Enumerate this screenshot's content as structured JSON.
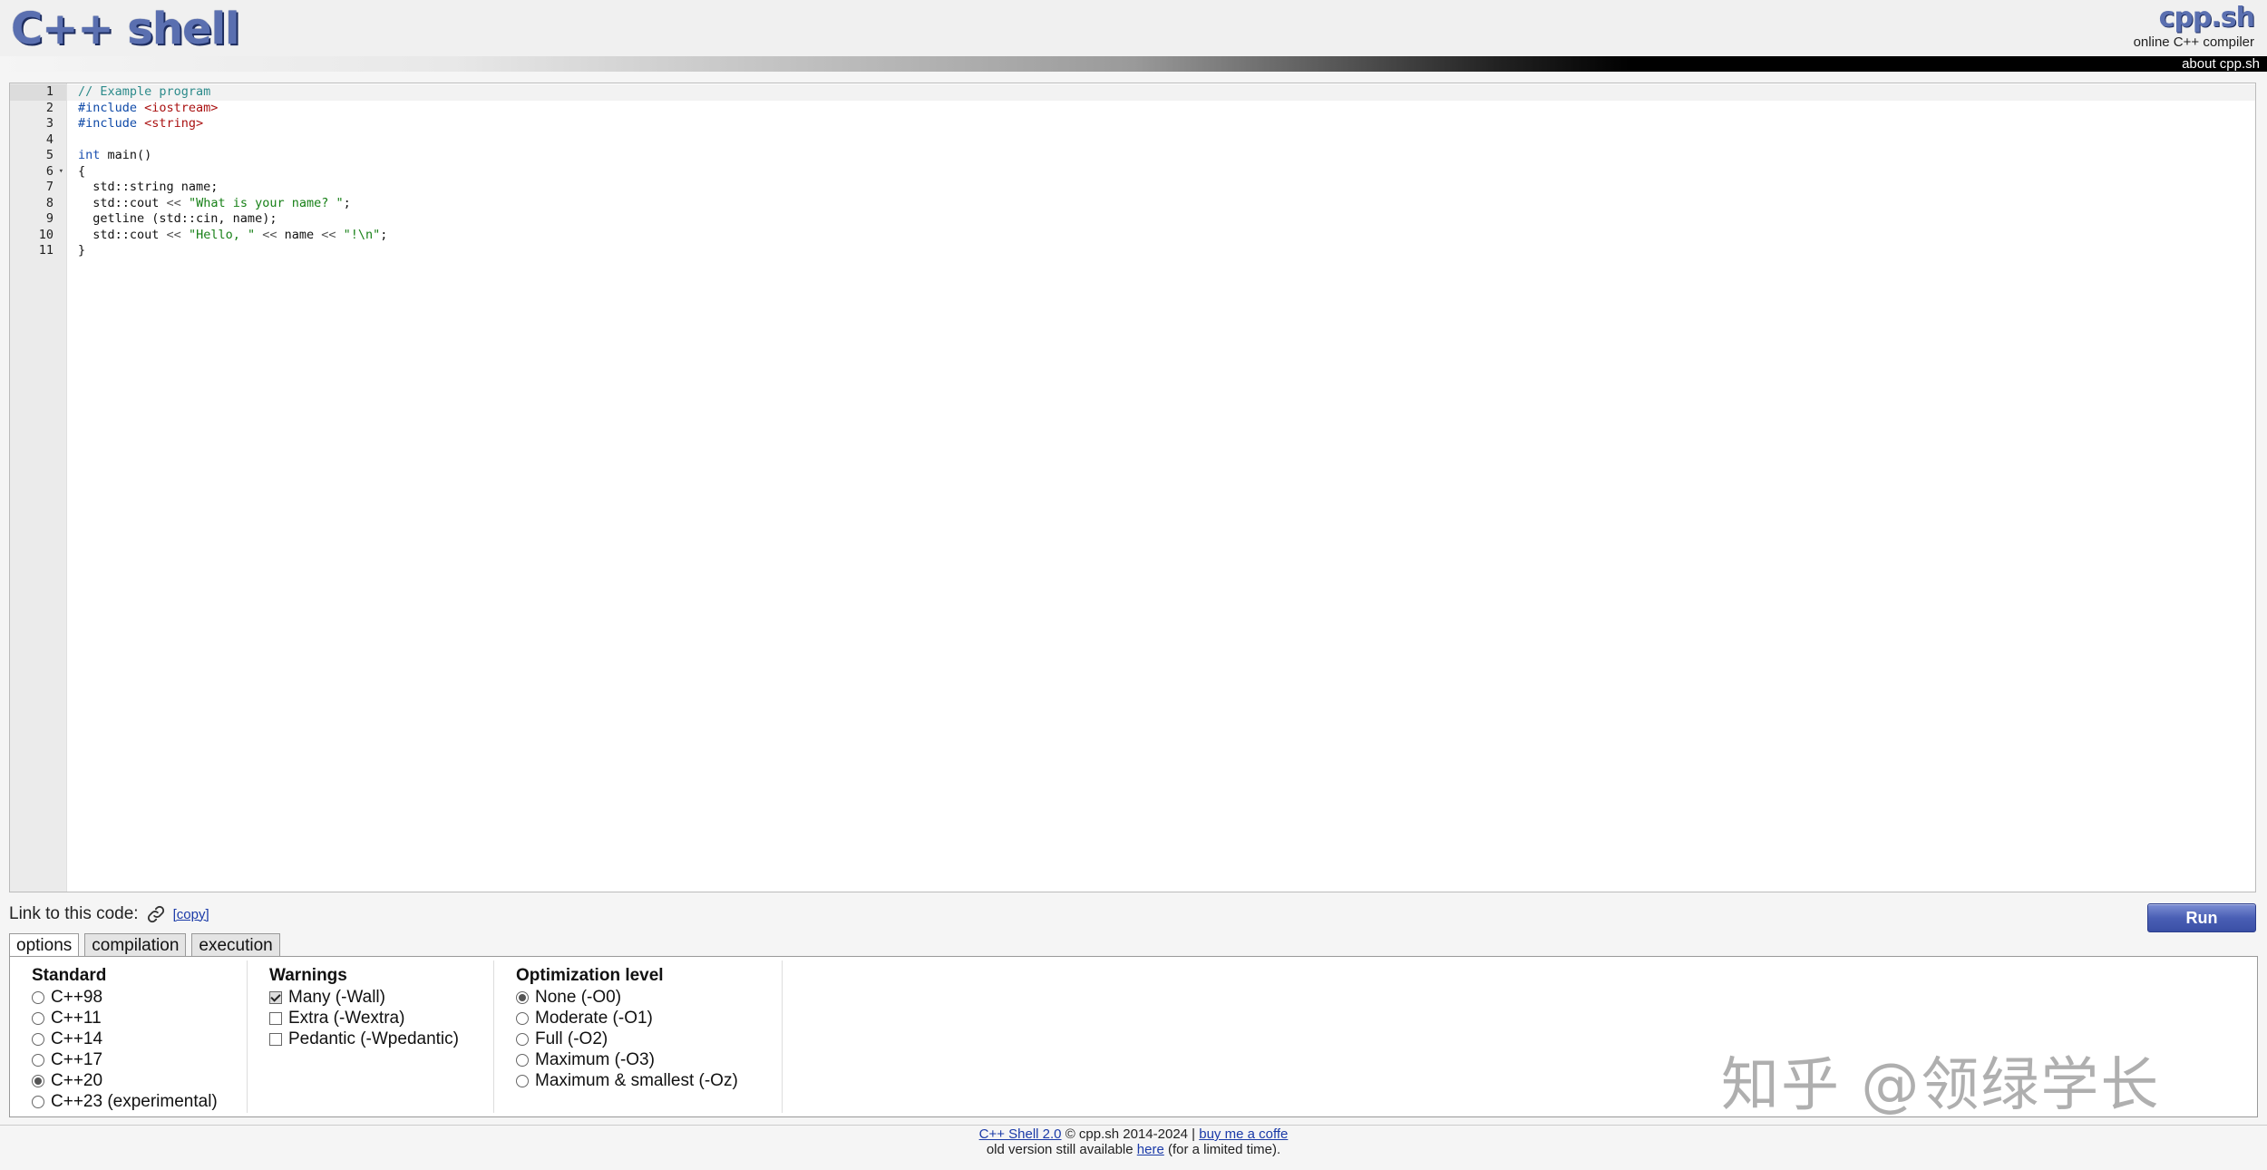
{
  "header": {
    "logo": "C++ shell",
    "brand": "cpp.sh",
    "tagline": "online C++ compiler",
    "about_link": "about cpp.sh"
  },
  "editor": {
    "active_line": 1,
    "lines": [
      [
        {
          "t": "// Example program",
          "c": "comment"
        }
      ],
      [
        {
          "t": "#include ",
          "c": "pp"
        },
        {
          "t": "<iostream>",
          "c": "header"
        }
      ],
      [
        {
          "t": "#include ",
          "c": "pp"
        },
        {
          "t": "<string>",
          "c": "header"
        }
      ],
      [],
      [
        {
          "t": "int",
          "c": "kw"
        },
        {
          "t": " main()",
          "c": "plain"
        }
      ],
      [
        {
          "t": "{",
          "c": "plain"
        }
      ],
      [
        {
          "t": "  std::string name;",
          "c": "plain"
        }
      ],
      [
        {
          "t": "  std::cout ",
          "c": "plain"
        },
        {
          "t": "<<",
          "c": "op"
        },
        {
          "t": " \"What is your name? \"",
          "c": "str"
        },
        {
          "t": ";",
          "c": "plain"
        }
      ],
      [
        {
          "t": "  getline (std::cin, name);",
          "c": "plain"
        }
      ],
      [
        {
          "t": "  std::cout ",
          "c": "plain"
        },
        {
          "t": "<<",
          "c": "op"
        },
        {
          "t": " \"Hello, \"",
          "c": "str"
        },
        {
          "t": " << ",
          "c": "op"
        },
        {
          "t": "name",
          "c": "plain"
        },
        {
          "t": " << ",
          "c": "op"
        },
        {
          "t": "\"!\\n\"",
          "c": "str"
        },
        {
          "t": ";",
          "c": "plain"
        }
      ],
      [
        {
          "t": "}",
          "c": "plain"
        }
      ]
    ],
    "line_numbers": [
      "1",
      "2",
      "3",
      "4",
      "5",
      "6",
      "7",
      "8",
      "9",
      "10",
      "11"
    ],
    "fold_line": 6
  },
  "link": {
    "label": "Link to this code:",
    "copy": "[copy]",
    "icon": "link-icon"
  },
  "run_label": "Run",
  "tabs": [
    {
      "label": "options",
      "active": true
    },
    {
      "label": "compilation",
      "active": false
    },
    {
      "label": "execution",
      "active": false
    }
  ],
  "options": {
    "standard": {
      "title": "Standard",
      "items": [
        {
          "label": "C++98",
          "checked": false
        },
        {
          "label": "C++11",
          "checked": false
        },
        {
          "label": "C++14",
          "checked": false
        },
        {
          "label": "C++17",
          "checked": false
        },
        {
          "label": "C++20",
          "checked": true
        },
        {
          "label": "C++23 (experimental)",
          "checked": false
        }
      ]
    },
    "warnings": {
      "title": "Warnings",
      "items": [
        {
          "label": "Many (-Wall)",
          "checked": true
        },
        {
          "label": "Extra (-Wextra)",
          "checked": false
        },
        {
          "label": "Pedantic (-Wpedantic)",
          "checked": false
        }
      ]
    },
    "optimization": {
      "title": "Optimization level",
      "items": [
        {
          "label": "None (-O0)",
          "checked": true
        },
        {
          "label": "Moderate (-O1)",
          "checked": false
        },
        {
          "label": "Full (-O2)",
          "checked": false
        },
        {
          "label": "Maximum (-O3)",
          "checked": false
        },
        {
          "label": "Maximum & smallest (-Oz)",
          "checked": false
        }
      ]
    }
  },
  "watermark": "知乎 @领绿学长",
  "footer": {
    "line1_link": "C++ Shell 2.0",
    "line1_text": " © cpp.sh 2014-2024 | ",
    "line1_link2": "buy me a coffe",
    "line2_pre": "old version still available ",
    "line2_link": "here",
    "line2_post": " (for a limited time)."
  },
  "colors": {
    "accent": "#5a6fb0",
    "run_button": "#4a5fb5",
    "link": "#1a3aa8"
  }
}
